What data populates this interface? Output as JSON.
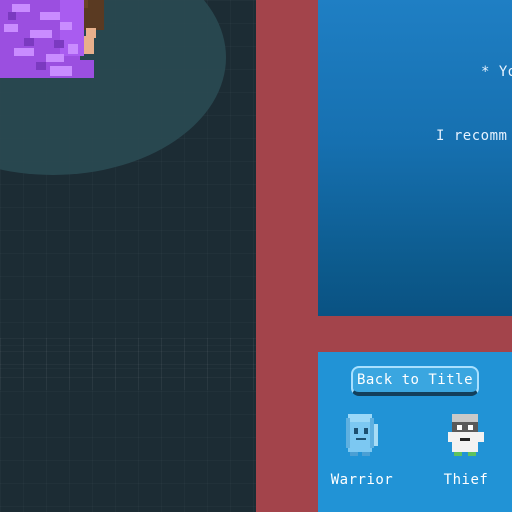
{
  "dialog": {
    "line_1": "* Yo",
    "line_2": "I recomm"
  },
  "menu": {
    "back_to_title_label": "Back to Title",
    "characters": [
      {
        "label": "Warrior",
        "icon": "warrior-icon"
      },
      {
        "label": "Thief",
        "icon": "thief-icon"
      }
    ]
  },
  "colors": {
    "game_bg": "#1c2c34",
    "spotlight": "#2a4a52",
    "frame": "#a3444b",
    "dialog_bg": "#1670b0",
    "panel_bg": "#2193d6",
    "player_purple": "#9b4fe0"
  }
}
